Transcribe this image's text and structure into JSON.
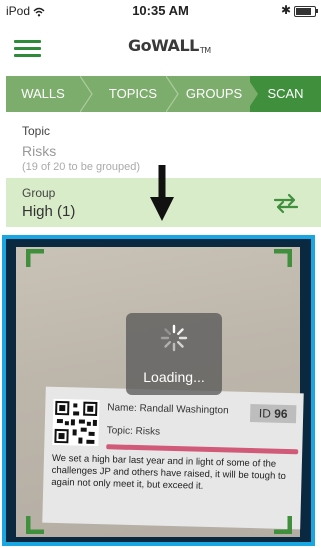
{
  "status_bar": {
    "carrier": "iPod",
    "time": "10:35 AM",
    "battery_level": 0.85
  },
  "header": {
    "logo_text": "GoWALL",
    "logo_tm": "TM"
  },
  "tabs": [
    {
      "label": "WALLS"
    },
    {
      "label": "TOPICS"
    },
    {
      "label": "GROUPS"
    },
    {
      "label": "SCAN",
      "active": true
    }
  ],
  "topic": {
    "label": "Topic",
    "value": "Risks",
    "note": "(19 of 20 to be grouped)"
  },
  "group": {
    "label": "Group",
    "value": "High (1)"
  },
  "camera": {
    "loading_text": "Loading...",
    "card": {
      "name": "Name: Randall Washington",
      "topic": "Topic: Risks",
      "id_prefix": "ID",
      "id_number": "96",
      "text": "We set a high bar last year and in light of some of the challenges JP and others have raised, it will be tough to again not only meet it, but exceed it."
    }
  },
  "colors": {
    "accent_green": "#3f8f3c",
    "tab_green": "#7dad6c",
    "group_bg": "#d9ecc9",
    "camera_border": "#1aa6e0"
  }
}
